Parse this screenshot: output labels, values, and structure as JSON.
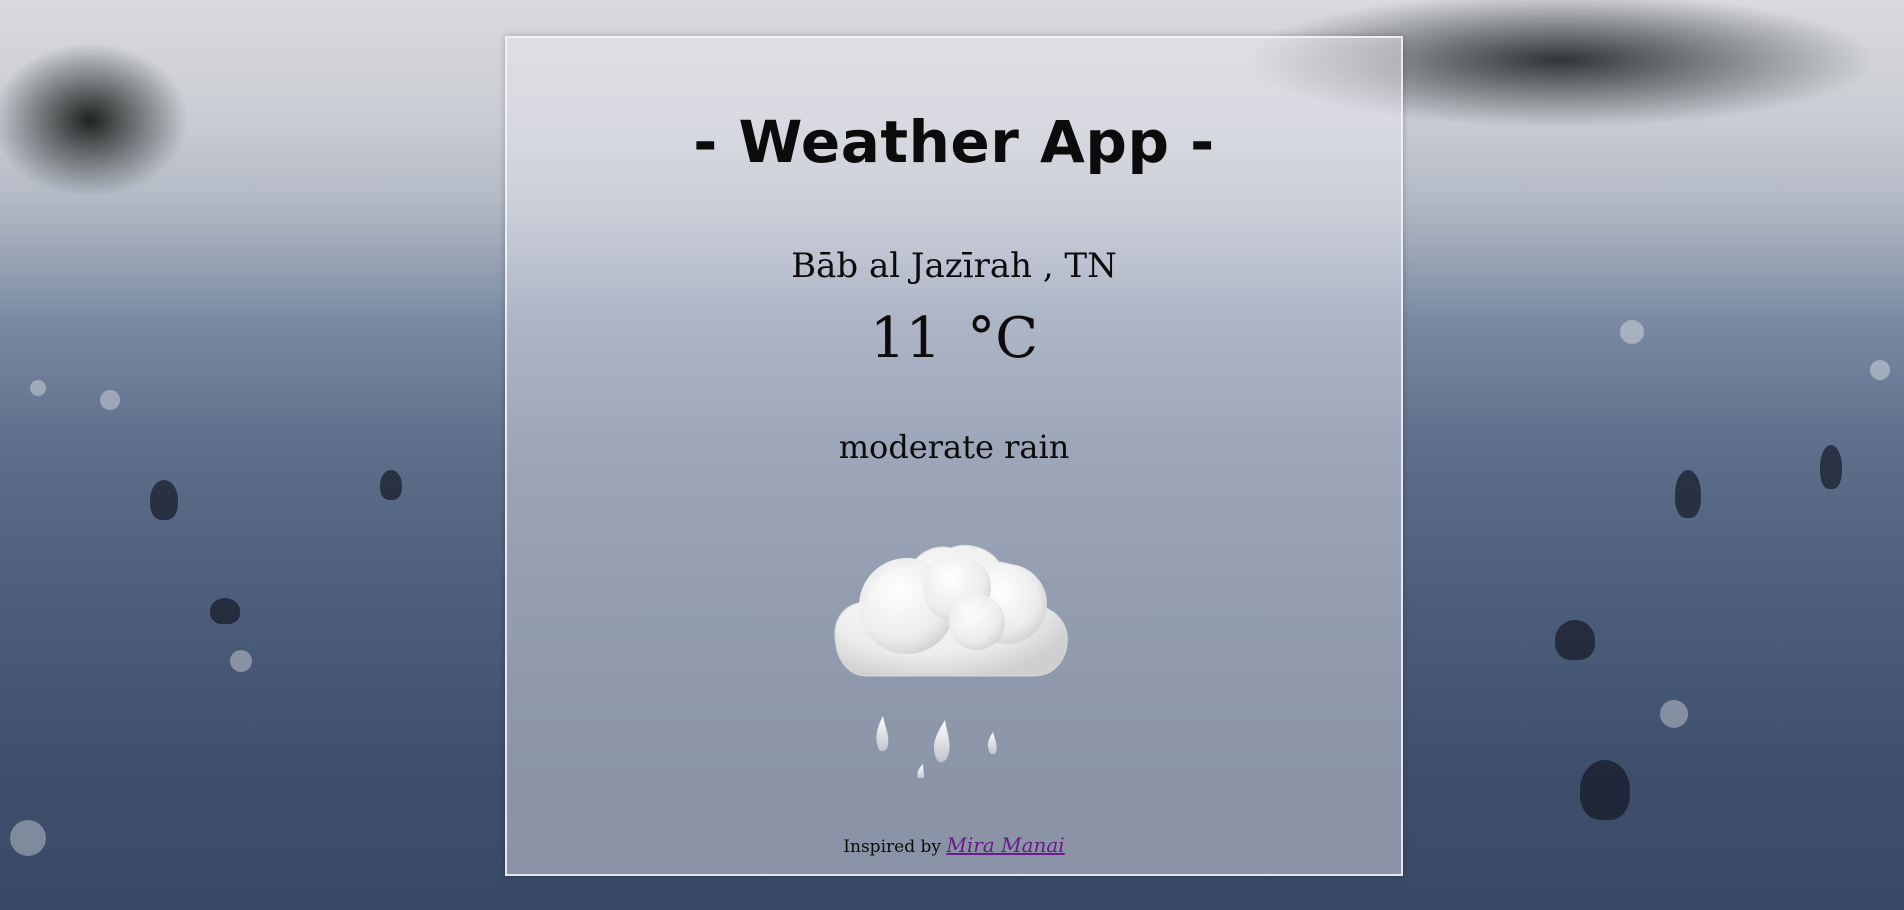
{
  "app": {
    "title": "- Weather App -"
  },
  "weather": {
    "location": "Bāb al Jazīrah , TN",
    "temperature": "11",
    "unit": "°C",
    "description": "moderate rain",
    "icon": "cloud-rain-icon"
  },
  "footer": {
    "prefix": "Inspired by",
    "link_text": "Mira Manai",
    "link_color": "#6a1a8a"
  }
}
